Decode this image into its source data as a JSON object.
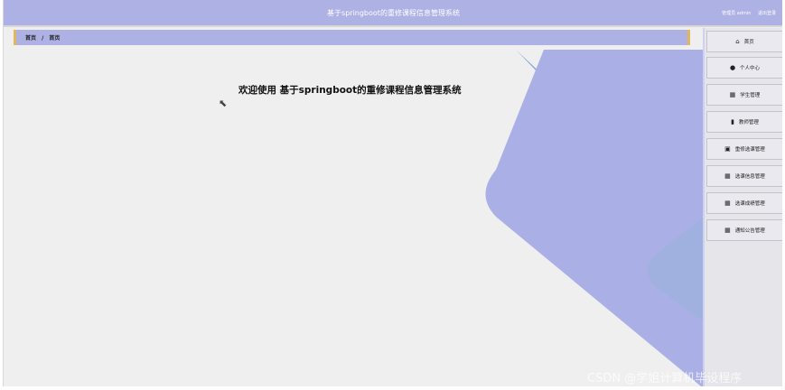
{
  "header": {
    "title": "基于springboot的重修课程信息管理系统",
    "user_label": "管理员 admin",
    "logout_label": "退出登录"
  },
  "breadcrumb": {
    "home": "首页",
    "separator": "/",
    "current": "首页"
  },
  "main": {
    "welcome_text": "欢迎使用 基于springboot的重修课程信息管理系统"
  },
  "sidebar": {
    "items": [
      {
        "label": "首页",
        "icon": "home-icon"
      },
      {
        "label": "个人中心",
        "icon": "user-icon"
      },
      {
        "label": "学生管理",
        "icon": "grid-icon"
      },
      {
        "label": "教师管理",
        "icon": "book-icon"
      },
      {
        "label": "重修选课管理",
        "icon": "clipboard-icon"
      },
      {
        "label": "选课信息管理",
        "icon": "grid-icon"
      },
      {
        "label": "选课成绩管理",
        "icon": "grid-icon"
      },
      {
        "label": "通知公告管理",
        "icon": "grid-icon"
      }
    ]
  },
  "watermark": "CSDN @学姐计算机毕设程序",
  "colors": {
    "header_bg": "#adb1e3",
    "accent_border": "#e2b659",
    "shape_purple": "#aab0e6",
    "shape_blue": "#84a9d3",
    "content_bg": "#efefef"
  }
}
